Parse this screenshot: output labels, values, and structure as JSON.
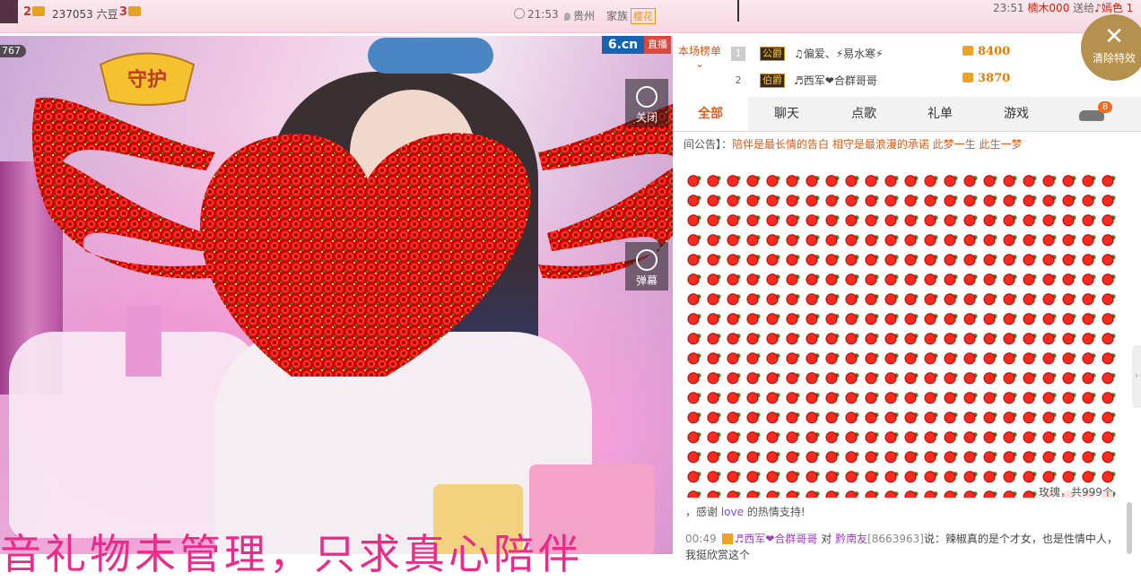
{
  "topbar": {
    "rank2": "2",
    "rank3": "3",
    "count_text": "237053 六豆",
    "time": "21:53",
    "location": "贵州",
    "family_label": "家族",
    "family_badge": "樱花",
    "feed_time": "23:51",
    "feed_user": "楠木000",
    "feed_action": "送给",
    "feed_target": "♪嫣色 1"
  },
  "video": {
    "viewers": "767",
    "logo": "6.cn",
    "live_label": "直播",
    "close_label": "关闭",
    "danmu_label": "弹幕",
    "guard_badge": "守护",
    "overlay_text": "音礼物未管理，只求真心陪伴"
  },
  "ranking": {
    "header": "本场榜单",
    "rows": [
      {
        "rank": "1",
        "title": "公爵",
        "name": "♫偏爱、⚡易水寒⚡",
        "score": "8400"
      },
      {
        "rank": "2",
        "title": "伯爵",
        "name": "♬西军❤合群哥哥",
        "score": "3870"
      }
    ]
  },
  "close_effects": "清除特效",
  "tabs": [
    "全部",
    "聊天",
    "点歌",
    "礼单",
    "游戏"
  ],
  "car_badge": "8",
  "notice": {
    "prefix": "间公告】：",
    "text": "陪伴是最长情的告白 相守是最浪漫的承诺 此梦一生 此生一梦"
  },
  "gift": {
    "summary": "玫瑰，共999个",
    "thanks_pre": "，感谢",
    "thanks_name": "love",
    "thanks_post": "的热情支持!"
  },
  "chat": {
    "time": "00:49",
    "user": "♬西军❤合群哥哥",
    "to": "对",
    "target": "黔南友",
    "target_id": "[8663963]",
    "says": "说：辣椒真的是个才女，也是性情中人，",
    "more": "我挺欣赏这个"
  },
  "colors": {
    "accent": "#e85c18",
    "brand_blue": "#1563b3",
    "rose_red": "#e11111",
    "pink_text": "#ec2a89"
  }
}
